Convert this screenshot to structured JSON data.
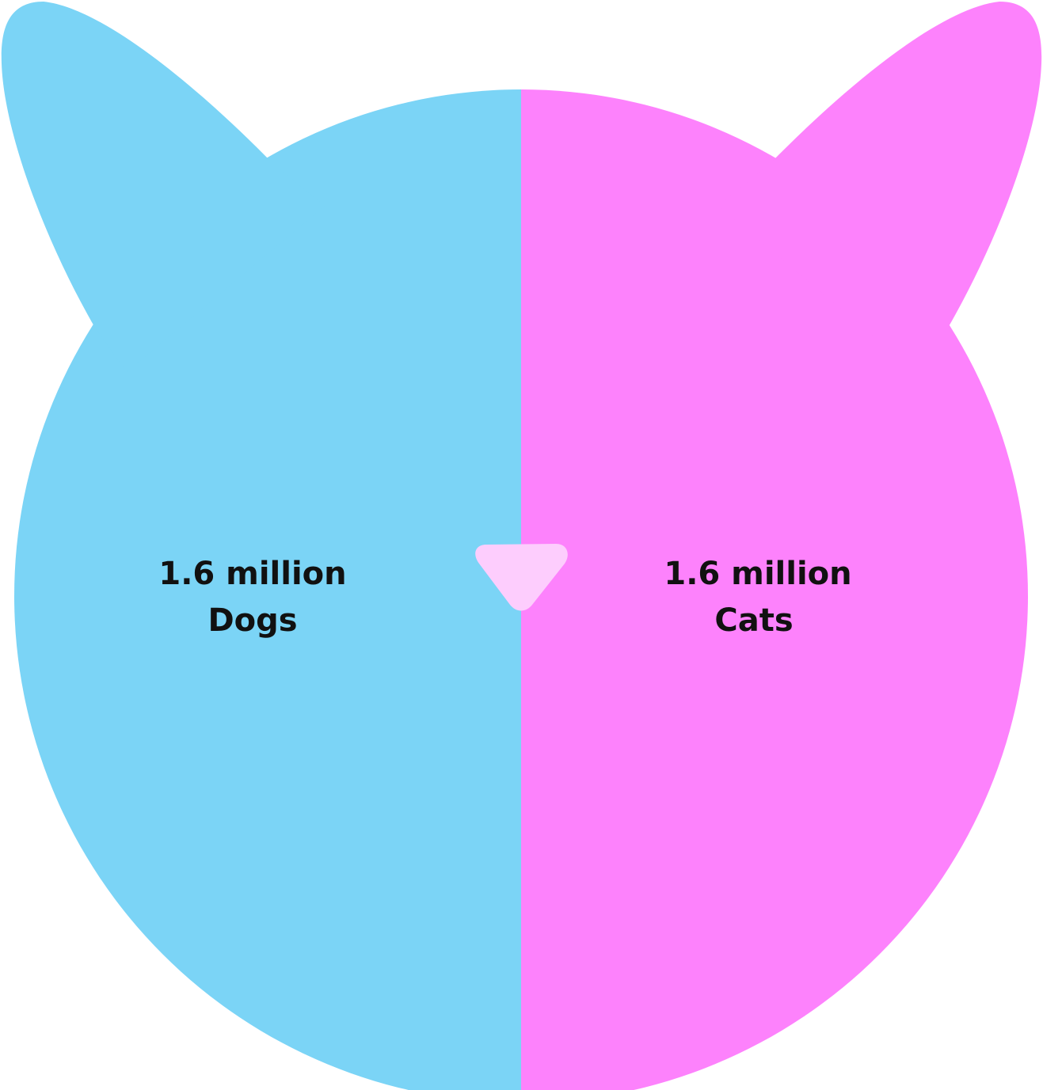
{
  "chart_data": {
    "type": "pie",
    "title": "",
    "slices": [
      {
        "label": "Dogs",
        "value": 1.6,
        "display_value": "1.6 million",
        "color": "#7bd4f6"
      },
      {
        "label": "Cats",
        "value": 1.6,
        "display_value": "1.6 million",
        "color": "#fd82fc"
      }
    ],
    "nose_color": "#fdcdfd",
    "legend": "none"
  }
}
